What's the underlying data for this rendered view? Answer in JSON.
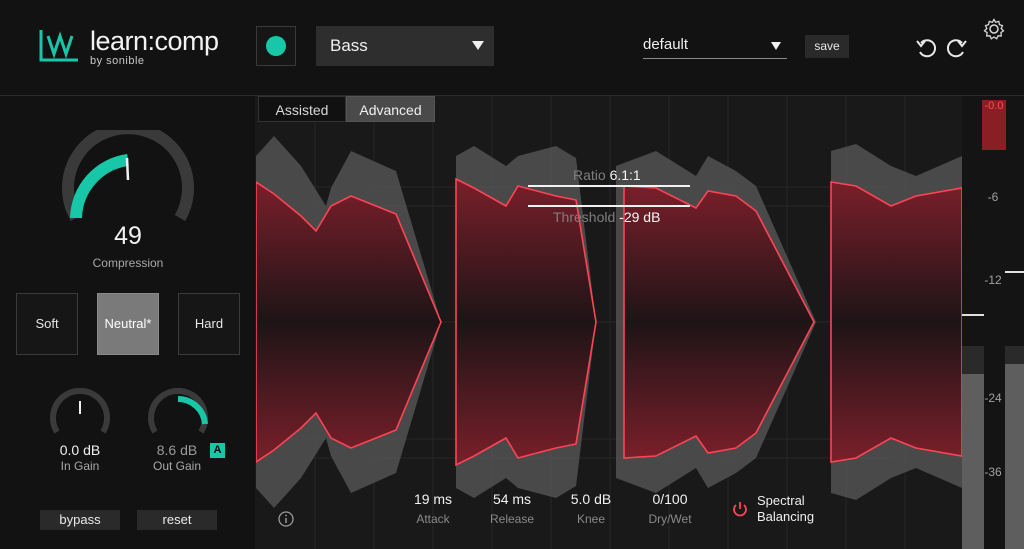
{
  "header": {
    "app_name": "learn:comp",
    "by_label": "by sonible",
    "profile": "Bass",
    "preset": "default",
    "save_label": "save"
  },
  "colors": {
    "accent": "#18c7a7",
    "waveform_red": "#ff4455",
    "panel_bg": "#121212"
  },
  "icons": [
    "logo-icon",
    "power-icon",
    "dropdown-arrow-icon",
    "undo-icon",
    "redo-icon",
    "gear-icon",
    "info-icon",
    "power-icon-spectral"
  ],
  "left_panel": {
    "compression": {
      "value": "49",
      "label": "Compression",
      "level": 0.49
    },
    "modes": [
      {
        "label": "Soft",
        "active": false
      },
      {
        "label": "Neutral*",
        "active": true
      },
      {
        "label": "Hard",
        "active": false
      }
    ],
    "in_gain": {
      "value": "0.0 dB",
      "label": "In Gain",
      "level": 0.5
    },
    "out_gain": {
      "value": "8.6 dB",
      "label": "Out Gain",
      "level": 0.74,
      "auto_badge": "A"
    },
    "bypass_label": "bypass",
    "reset_label": "reset"
  },
  "display": {
    "tabs": [
      {
        "label": "Assisted",
        "active": false
      },
      {
        "label": "Advanced",
        "active": true
      }
    ],
    "ratio": {
      "label": "Ratio",
      "value": "6.1:1"
    },
    "threshold": {
      "label": "Threshold",
      "value": "-29 dB"
    },
    "params": [
      {
        "value": "19 ms",
        "label": "Attack"
      },
      {
        "value": "54 ms",
        "label": "Release"
      },
      {
        "value": "5.0 dB",
        "label": "Knee"
      },
      {
        "value": "0/100",
        "label": "Dry/Wet"
      }
    ],
    "spectral_balancing_label": "Spectral Balancing",
    "meter": {
      "peak": "-0.0",
      "scale": [
        "-6",
        "-12",
        "-24",
        "-36"
      ]
    }
  }
}
